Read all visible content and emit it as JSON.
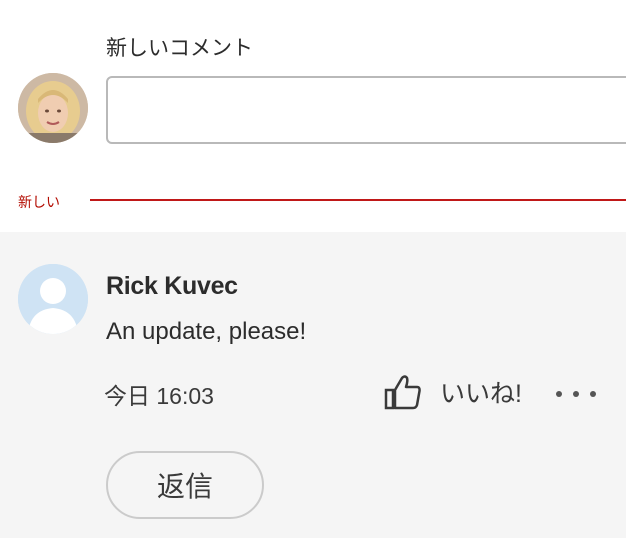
{
  "new_comment": {
    "label": "新しいコメント",
    "input_value": "",
    "input_placeholder": ""
  },
  "divider": {
    "label": "新しい",
    "color": "#c01818"
  },
  "comment": {
    "author": "Rick Kuvec",
    "text": "An update, please!",
    "timestamp": "今日 16:03",
    "like_label": "いいね!",
    "like_icon": "thumbs-up-icon",
    "more_icon": "more-options-icon",
    "reply_label": "返信"
  },
  "colors": {
    "accent_red": "#c01818",
    "thread_background": "#f5f5f5",
    "text": "#2c2c2c"
  }
}
